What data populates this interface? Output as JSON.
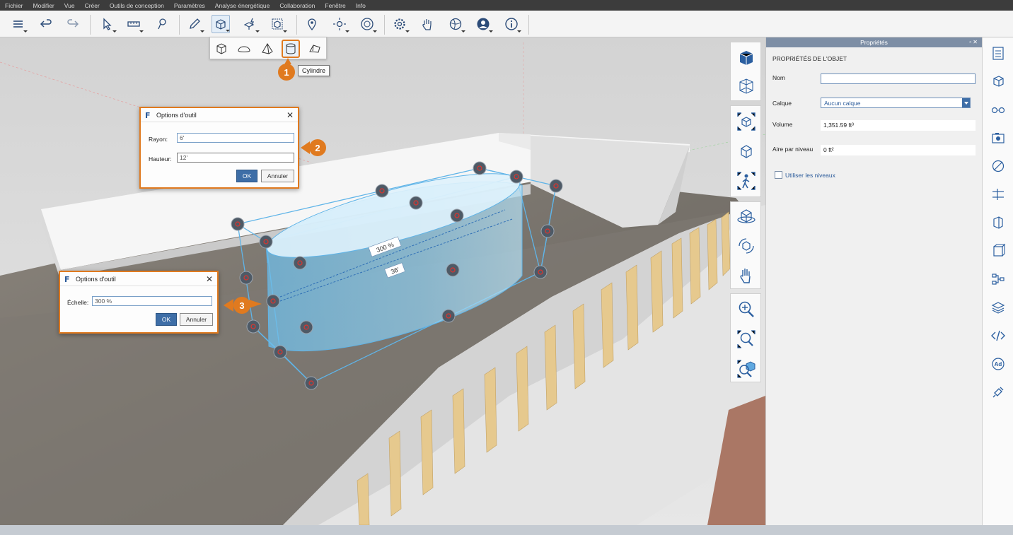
{
  "menu": [
    "Fichier",
    "Modifier",
    "Vue",
    "Créer",
    "Outils de conception",
    "Paramètres",
    "Analyse énergétique",
    "Collaboration",
    "Fenêtre",
    "Info"
  ],
  "toolbar": {
    "icons": [
      "layers-list-icon",
      "undo-icon",
      "redo-icon",
      "select-arrow-icon",
      "measure-icon",
      "pin-icon",
      "pencil-icon",
      "solid-tools-icon",
      "push-pull-icon",
      "frame-object-icon",
      "location-icon",
      "sun-icon",
      "compass-icon",
      "settings-icon",
      "hand-icon",
      "globe-icon",
      "user-icon",
      "info-icon"
    ]
  },
  "flyout": {
    "items": [
      "cube-icon",
      "dome-icon",
      "pyramid-icon",
      "cylinder-icon",
      "wedge-icon"
    ],
    "selected": "cylinder-icon",
    "tooltip": "Cylindre"
  },
  "callouts": [
    "1",
    "2",
    "3"
  ],
  "dialog_cylinder": {
    "title": "Options d'outil",
    "radius_label": "Rayon:",
    "radius_value": "6'",
    "height_label": "Hauteur:",
    "height_value": "12'",
    "ok": "OK",
    "cancel": "Annuler"
  },
  "dialog_scale": {
    "title": "Options d'outil",
    "scale_label": "Échelle:",
    "scale_value": "300 %",
    "ok": "OK",
    "cancel": "Annuler"
  },
  "viewport": {
    "dimension_scale": "300 %",
    "dimension_length": "36'"
  },
  "properties": {
    "panel_title": "Propriétés",
    "panel_controls": "▫ ✕",
    "section": "PROPRIÉTÉS DE L'OBJET",
    "name_label": "Nom",
    "name_value": "",
    "layer_label": "Calque",
    "layer_value": "Aucun calque",
    "volume_label": "Volume",
    "volume_value": "1,351.59 ft³",
    "area_label": "Aire par niveau",
    "area_value": "0 ft²",
    "use_levels_label": "Utiliser les niveaux",
    "use_levels_checked": false
  },
  "colors": {
    "accent": "#e07a1f",
    "selection": "#5fb4e8",
    "button_primary": "#3e6ea7"
  }
}
